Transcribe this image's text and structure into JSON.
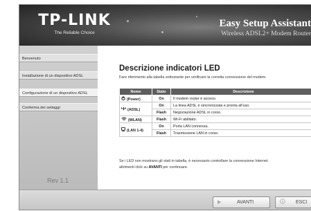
{
  "header": {
    "logo": "TP-LINK",
    "tagline": "The Reliable Choice",
    "product_title": "Easy Setup Assistant",
    "product_subtitle": "Wireless ADSL2+ Modem Router"
  },
  "sidebar": {
    "items": [
      {
        "label": "Benvenuto",
        "active": false
      },
      {
        "label": "Installazione di un dispositivo ADSL",
        "active": false
      },
      {
        "label": "Configurazione di un dispositivo ADSL",
        "active": true
      },
      {
        "label": "Conferma dei settaggi",
        "active": false
      }
    ],
    "version": "Rev 1.1"
  },
  "main": {
    "title": "Descrizione indicatori LED",
    "intro": "Fare riferimento alla tabella sottostante per verificare la corretta connessione del modem.",
    "table": {
      "headers": [
        "Nome",
        "Stato",
        "Descrizione"
      ],
      "rows": [
        {
          "name": "(Power)",
          "icon": "power-icon",
          "state": "On",
          "description": "Il modem router è acceso."
        },
        {
          "name": "(ADSL)",
          "icon": "adsl-icon",
          "state": "On",
          "description": "La linea ADSL è sincronizzata e pronta all'uso."
        },
        {
          "name": "",
          "icon": "",
          "state": "Flash",
          "description": "Negoziazione ADSL in corso."
        },
        {
          "name": "(WLAN)",
          "icon": "wlan-icon",
          "state": "Flash",
          "description": "Wi-Fi abilitato."
        },
        {
          "name": "(LAN 1-4)",
          "icon": "lan-icon",
          "state": "On",
          "description": "Porta LAN connessa."
        },
        {
          "name": "",
          "icon": "",
          "state": "Flash",
          "description": "Trasmissione LAN in corso."
        }
      ]
    },
    "note_line1": "Se i LED non mostrano gli stati in tabella, è necessario controllare la connessione Internet.",
    "note_line2_pre": "altrimenti click su ",
    "note_line2_bold": "AVANTI",
    "note_line2_post": " per continuare."
  },
  "footer": {
    "next_label": "AVANTI",
    "next_icon": "play-icon",
    "exit_label": "ESCI",
    "exit_icon": "info-icon"
  },
  "colors": {
    "header_dark": "#242424",
    "table_header": "#5e5e5e",
    "sidebar": "#d0d0d0",
    "footer": "#c4c4c4"
  }
}
